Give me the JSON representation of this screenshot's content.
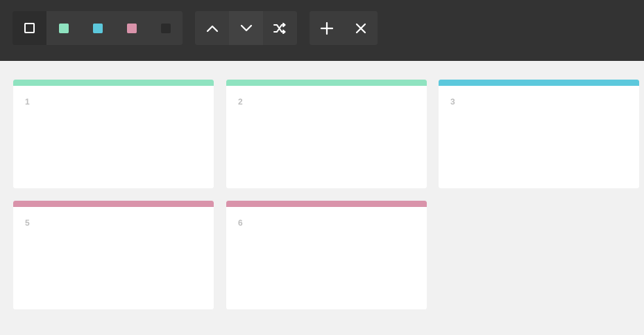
{
  "colors": {
    "mint": "#8fe3c0",
    "sky": "#5cc8dc",
    "rose": "#d993aa",
    "charcoal": "#2b2b2b",
    "white": "#ffffff"
  },
  "toolbar": {
    "color_buttons": [
      {
        "name": "white-outline",
        "icon": "square-outline-icon"
      },
      {
        "name": "mint",
        "icon": "mint-swatch-icon"
      },
      {
        "name": "sky",
        "icon": "sky-swatch-icon"
      },
      {
        "name": "rose",
        "icon": "rose-swatch-icon"
      },
      {
        "name": "charcoal",
        "icon": "charcoal-swatch-icon"
      }
    ],
    "sort_buttons": [
      {
        "name": "move-up",
        "icon": "chevron-up-icon"
      },
      {
        "name": "move-down",
        "icon": "chevron-down-icon"
      },
      {
        "name": "shuffle",
        "icon": "shuffle-icon"
      }
    ],
    "action_buttons": [
      {
        "name": "add",
        "icon": "plus-icon"
      },
      {
        "name": "delete",
        "icon": "close-icon"
      }
    ]
  },
  "cards": [
    {
      "number": "1",
      "color": "#8fe3c0"
    },
    {
      "number": "2",
      "color": "#8fe3c0"
    },
    {
      "number": "3",
      "color": "#5cc8dc"
    },
    {
      "number": "5",
      "color": "#d993aa"
    },
    {
      "number": "6",
      "color": "#d993aa"
    }
  ]
}
